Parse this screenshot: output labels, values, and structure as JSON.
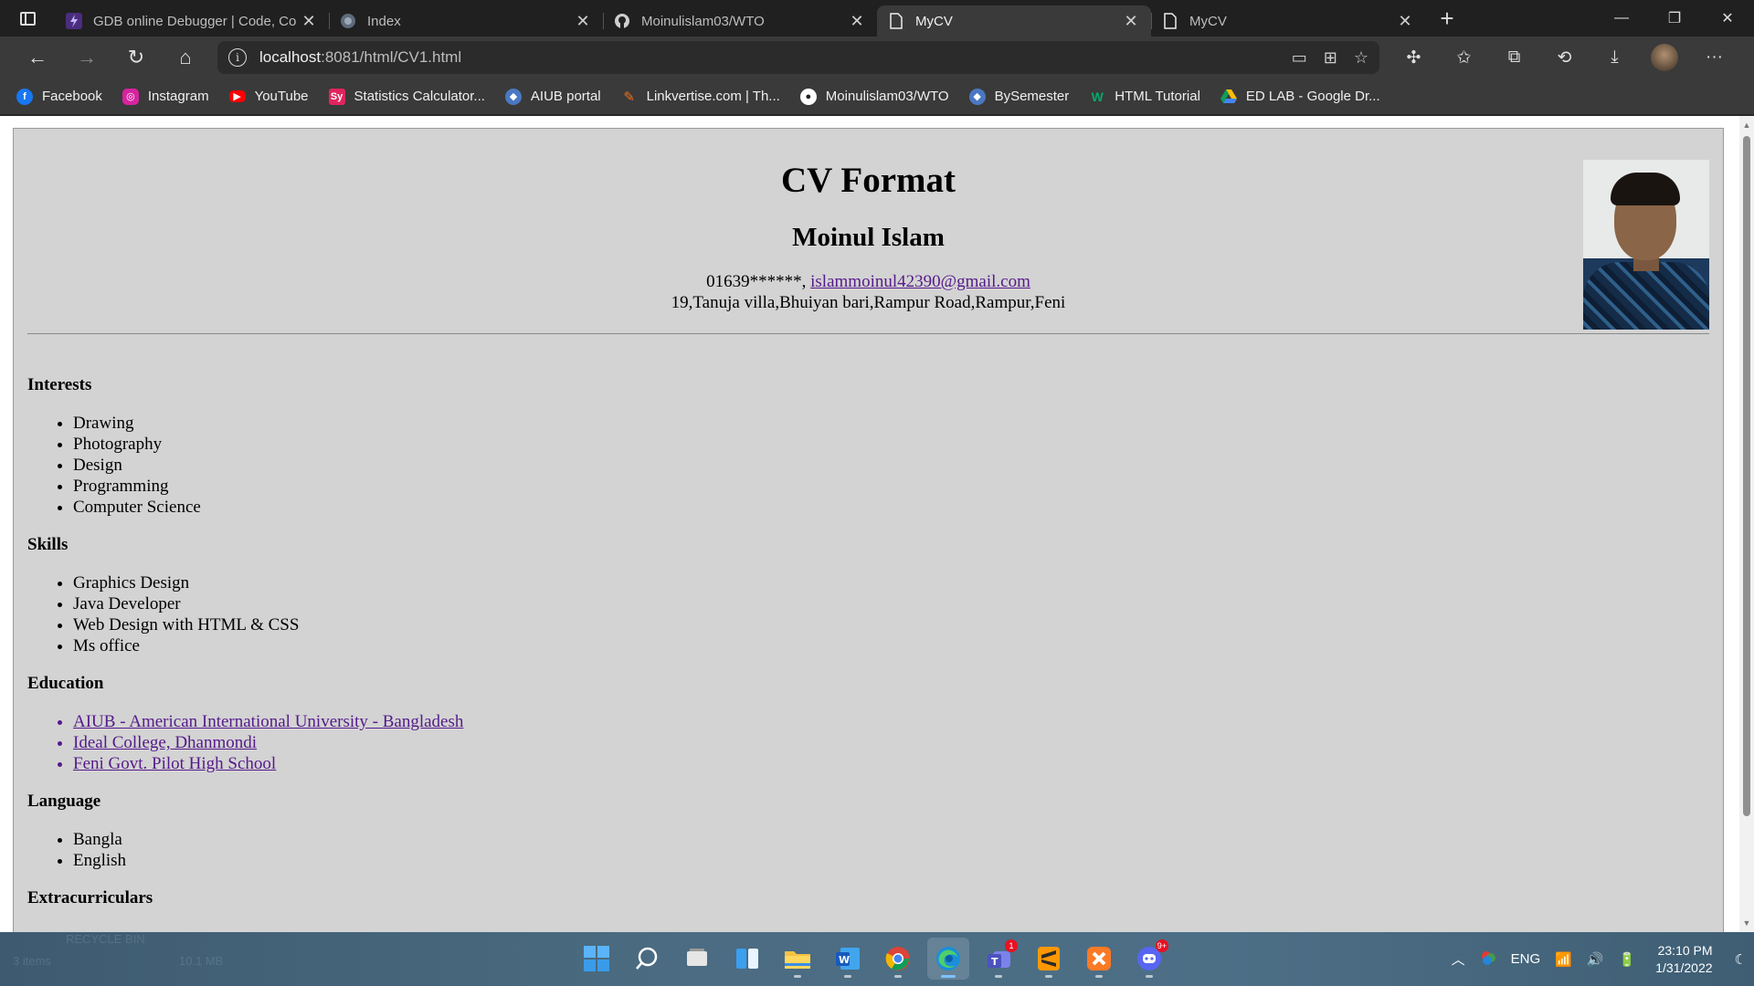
{
  "browser": {
    "tabs": [
      {
        "title": "GDB online Debugger | Code, Co",
        "icon": "gdb-icon",
        "active": false
      },
      {
        "title": "Index",
        "icon": "globe-icon",
        "active": false
      },
      {
        "title": "Moinulislam03/WTO",
        "icon": "github-icon",
        "active": false
      },
      {
        "title": "MyCV",
        "icon": "page-icon",
        "active": true
      },
      {
        "title": "MyCV",
        "icon": "page-icon",
        "active": false
      }
    ],
    "address": {
      "host": "localhost",
      "path": ":8081/html/CV1.html"
    },
    "bookmarks": [
      {
        "label": "Facebook",
        "icon": "facebook-icon",
        "color": "#1877f2"
      },
      {
        "label": "Instagram",
        "icon": "instagram-icon",
        "color": "#d6249f"
      },
      {
        "label": "YouTube",
        "icon": "youtube-icon",
        "color": "#ff0000"
      },
      {
        "label": "Statistics Calculator...",
        "icon": "sy-icon",
        "color": "#e0245e"
      },
      {
        "label": "AIUB portal",
        "icon": "aiub-icon",
        "color": "#4a78c2"
      },
      {
        "label": "Linkvertise.com | Th...",
        "icon": "linkvertise-icon",
        "color": "#f2711c"
      },
      {
        "label": "Moinulislam03/WTO",
        "icon": "github-icon",
        "color": "#ffffff"
      },
      {
        "label": "BySemester",
        "icon": "bysemester-icon",
        "color": "#4a78c2"
      },
      {
        "label": "HTML Tutorial",
        "icon": "w3schools-icon",
        "color": "#04aa6d"
      },
      {
        "label": "ED LAB - Google Dr...",
        "icon": "google-drive-icon",
        "color": "#fbbc04"
      }
    ]
  },
  "cv": {
    "title": "CV Format",
    "name": "Moinul Islam",
    "phone": "01639******,",
    "email": "islammoinul42390@gmail.com",
    "address": "19,Tanuja villa,Bhuiyan bari,Rampur Road,Rampur,Feni",
    "sections": {
      "interests": {
        "heading": "Interests",
        "items": [
          "Drawing",
          "Photography",
          "Design",
          "Programming",
          "Computer Science"
        ]
      },
      "skills": {
        "heading": "Skills",
        "items": [
          "Graphics Design",
          "Java Developer",
          "Web Design with HTML & CSS",
          "Ms office"
        ]
      },
      "education": {
        "heading": "Education",
        "items": [
          "AIUB - American International University - Bangladesh",
          "Ideal College, Dhanmondi",
          "Feni Govt. Pilot High School"
        ]
      },
      "language": {
        "heading": "Language",
        "items": [
          "Bangla",
          "English"
        ]
      },
      "extracurriculars": {
        "heading": "Extracurriculars"
      }
    }
  },
  "taskbar": {
    "ghost_text": {
      "items": "3 items",
      "size": "10.1 MB",
      "recycle": "RECYCLE BIN"
    },
    "apps": [
      {
        "name": "start-icon",
        "active": false
      },
      {
        "name": "search-icon",
        "active": false
      },
      {
        "name": "task-view-icon",
        "active": false
      },
      {
        "name": "widgets-icon",
        "active": false
      },
      {
        "name": "file-explorer-icon",
        "active": false
      },
      {
        "name": "word-icon",
        "active": false
      },
      {
        "name": "chrome-icon",
        "active": false
      },
      {
        "name": "edge-icon",
        "active": true
      },
      {
        "name": "teams-icon",
        "active": false,
        "badge": "1"
      },
      {
        "name": "sublime-text-icon",
        "active": false
      },
      {
        "name": "xampp-icon",
        "active": false
      },
      {
        "name": "discord-icon",
        "active": false,
        "badge": "9+"
      }
    ],
    "tray": {
      "language": "ENG",
      "time": "23:10 PM",
      "date": "1/31/2022"
    }
  }
}
